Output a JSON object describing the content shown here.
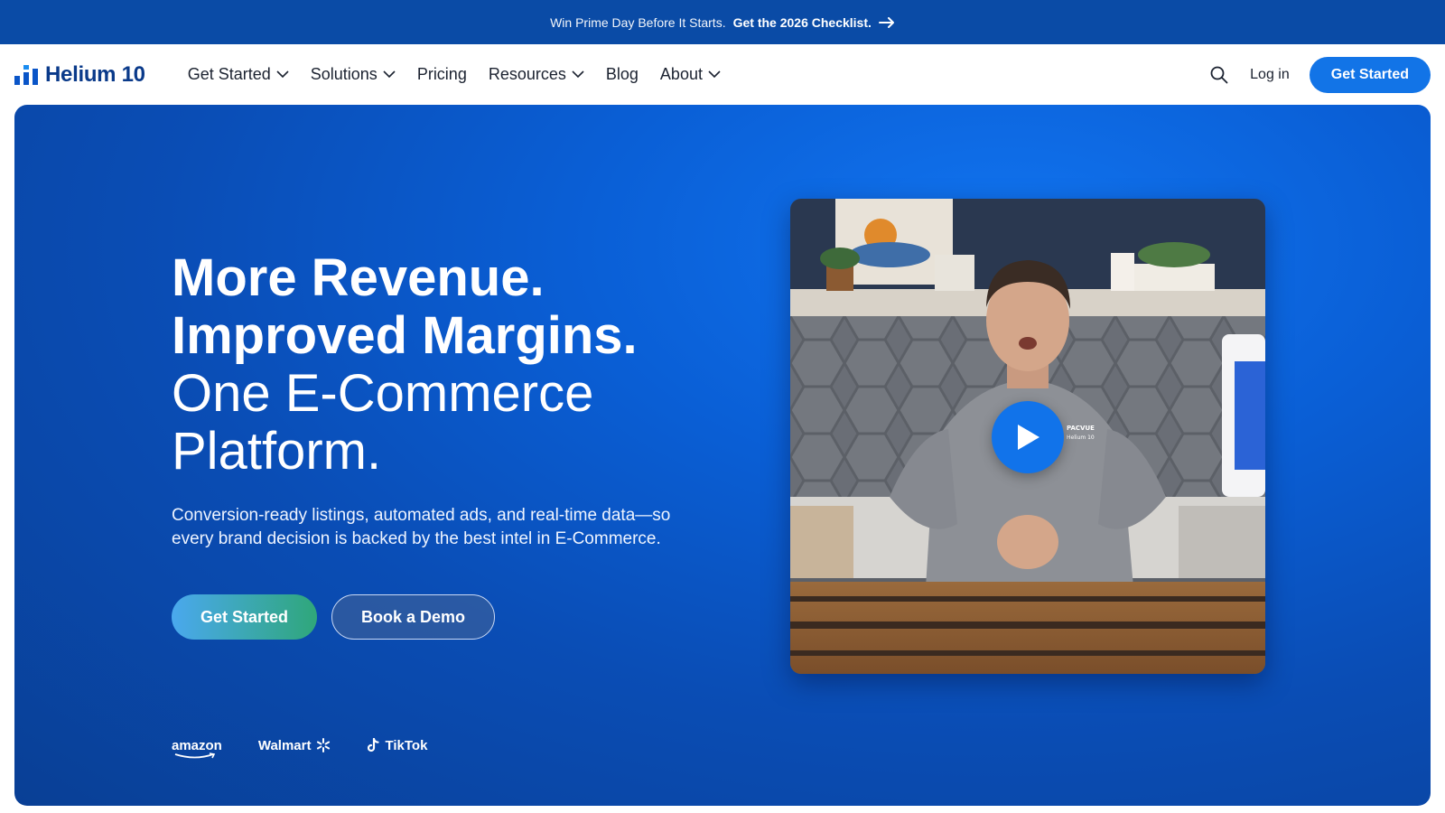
{
  "announcement": {
    "lead": "Win Prime Day Before It Starts.",
    "cta": "Get the 2026 Checklist."
  },
  "nav": {
    "logo": "Helium 10",
    "items": [
      {
        "label": "Get Started",
        "dropdown": true
      },
      {
        "label": "Solutions",
        "dropdown": true
      },
      {
        "label": "Pricing",
        "dropdown": false
      },
      {
        "label": "Resources",
        "dropdown": true
      },
      {
        "label": "Blog",
        "dropdown": false
      },
      {
        "label": "About",
        "dropdown": true
      }
    ],
    "login": "Log in",
    "cta": "Get Started"
  },
  "hero": {
    "headline_line1": "More Revenue.",
    "headline_line2": "Improved Margins.",
    "headline_line3": "One E-Commerce",
    "headline_line4": "Platform.",
    "subtext": "Conversion-ready listings, automated ads, and real-time data—so every brand decision is backed by the best intel in E-Commerce.",
    "primary_button": "Get Started",
    "secondary_button": "Book a Demo",
    "partners": [
      "amazon",
      "Walmart",
      "TikTok"
    ]
  },
  "video": {
    "shirt_text_1": "PACVUE",
    "shirt_text_2": "Helium 10"
  },
  "colors": {
    "brand_blue": "#1274e7",
    "announce_bg": "#0a4ba6",
    "logo_navy": "#0a3a8a"
  },
  "icons": {
    "logo": "helium10-bars-icon",
    "search": "search-icon",
    "dropdown": "chevron-down-icon",
    "arrow": "arrow-right-icon",
    "play": "play-icon"
  }
}
